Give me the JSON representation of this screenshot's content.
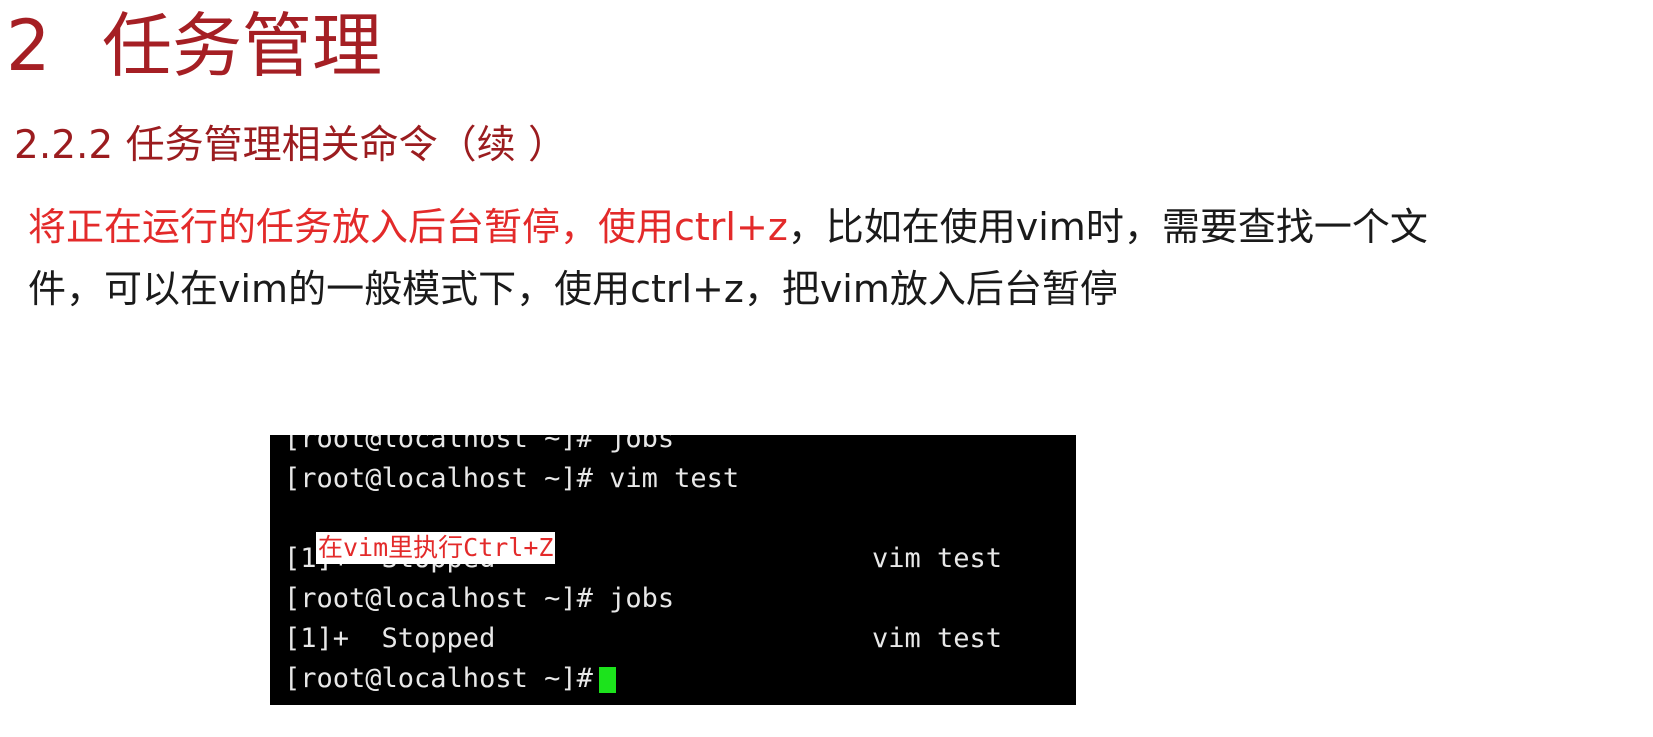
{
  "slide": {
    "section_number": "2",
    "section_title": "任务管理",
    "subtitle": "2.2.2 任务管理相关命令（续 ）",
    "paragraph": {
      "highlight": "将正在运行的任务放入后台暂停，使用ctrl+z",
      "rest_line1": "，比如在使用vim时，需要查找一个文",
      "line2": "件，可以在vim的一般模式下，使用ctrl+z，把vim放入后台暂停"
    },
    "colors": {
      "title": "#a51f24",
      "highlight": "#e32a2a",
      "terminal_bg": "#000000",
      "cursor": "#1ce31c"
    }
  },
  "terminal": {
    "lines": [
      {
        "text": "[root@localhost ~]# jobs"
      },
      {
        "text": "[root@localhost ~]# vim test"
      },
      {
        "text": "[1]+  Stopped",
        "right": "vim test"
      },
      {
        "text": "[root@localhost ~]# jobs"
      },
      {
        "text": "[1]+  Stopped",
        "right": "vim test"
      },
      {
        "text": "[root@localhost ~]#"
      }
    ],
    "annotation": "在vim里执行Ctrl+Z"
  }
}
